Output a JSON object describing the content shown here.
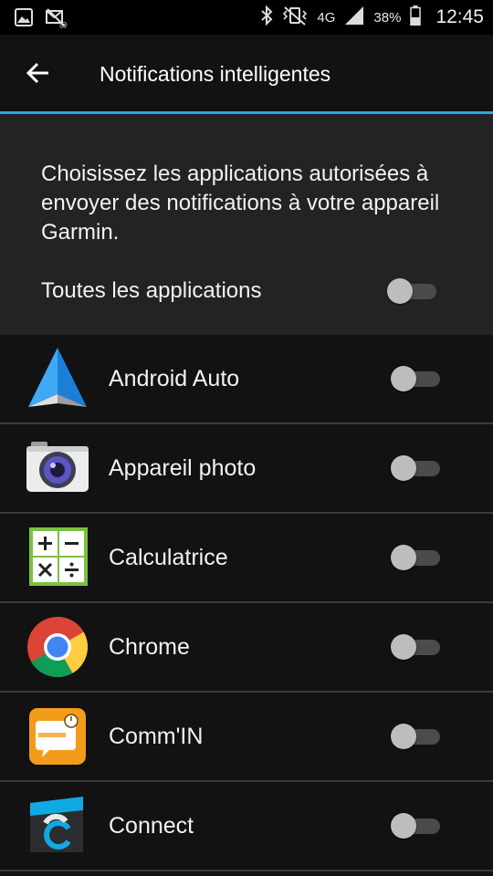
{
  "status_bar": {
    "icons_left": [
      "image-icon",
      "mail-muted-icon"
    ],
    "icons_right": [
      "bluetooth-icon",
      "vibrate-icon",
      "signal-icon",
      "battery-icon"
    ],
    "network": "4G",
    "battery": "38%",
    "time": "12:45"
  },
  "app_bar": {
    "title": "Notifications intelligentes",
    "back_icon": "arrow-back-icon",
    "accent_color": "#29a8e0"
  },
  "intro": {
    "description": "Choisissez les applications autorisées à envoyer des notifications à votre appareil Garmin.",
    "all_apps_label": "Toutes les applications",
    "all_apps_enabled": false
  },
  "apps": [
    {
      "name": "Android Auto",
      "icon": "android-auto-icon",
      "enabled": false
    },
    {
      "name": "Appareil photo",
      "icon": "camera-icon",
      "enabled": false
    },
    {
      "name": "Calculatrice",
      "icon": "calculator-icon",
      "enabled": false
    },
    {
      "name": "Chrome",
      "icon": "chrome-icon",
      "enabled": false
    },
    {
      "name": "Comm'IN",
      "icon": "commin-icon",
      "enabled": false
    },
    {
      "name": "Connect",
      "icon": "garmin-connect-icon",
      "enabled": false
    }
  ]
}
